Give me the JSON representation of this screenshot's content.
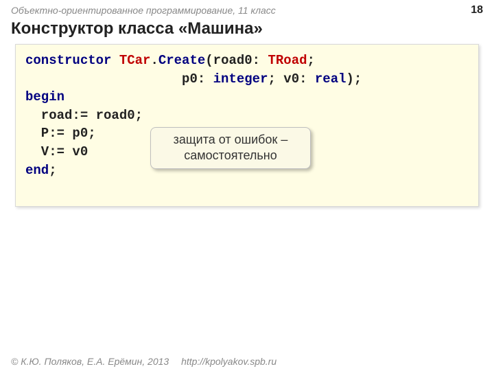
{
  "header": {
    "course_title": "Объектно-ориентированное программирование, 11 класс",
    "page_number": "18"
  },
  "title": "Конструктор класса «Машина»",
  "code": {
    "l1a": "constructor",
    "l1b": " TCar",
    "l1c": ".",
    "l1d": "Create",
    "l1e": "(road0: ",
    "l1f": "TRoad",
    "l1g": ";",
    "l2a": "                    p0: ",
    "l2b": "integer",
    "l2c": "; v0: ",
    "l2d": "real",
    "l2e": ");",
    "l3": "begin",
    "l4": "  road:= road0;",
    "l5": "  P:= p0;",
    "l6": "  V:= v0",
    "l7": "end",
    "l7b": ";"
  },
  "callout": "защита от ошибок – самостоятельно",
  "footer": {
    "copyright": "© К.Ю. Поляков, Е.А. Ерёмин, 2013",
    "link": "http://kpolyakov.spb.ru"
  }
}
